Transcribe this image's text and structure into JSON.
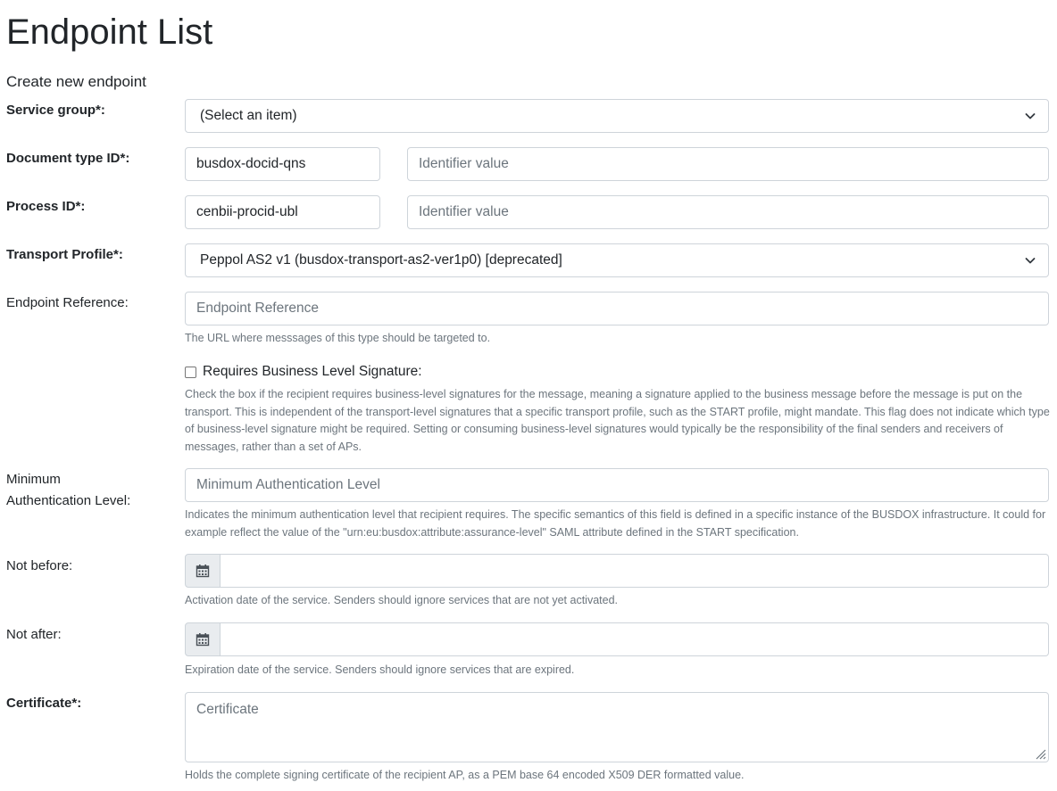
{
  "page": {
    "title": "Endpoint List",
    "subtitle": "Create new endpoint"
  },
  "service_group": {
    "label": "Service group*:",
    "selected": "(Select an item)"
  },
  "document_type": {
    "label": "Document type ID*:",
    "scheme_value": "busdox-docid-qns",
    "value_placeholder": "Identifier value"
  },
  "process": {
    "label": "Process ID*:",
    "scheme_value": "cenbii-procid-ubl",
    "value_placeholder": "Identifier value"
  },
  "transport_profile": {
    "label": "Transport Profile*:",
    "selected": "Peppol AS2 v1 (busdox-transport-as2-ver1p0) [deprecated]"
  },
  "endpoint_reference": {
    "label": "Endpoint Reference:",
    "placeholder": "Endpoint Reference",
    "hint": "The URL where messsages of this type should be targeted to."
  },
  "business_signature": {
    "label": "Requires Business Level Signature:",
    "checked": false,
    "hint": "Check the box if the recipient requires business-level signatures for the message, meaning a signature applied to the business message before the message is put on the transport. This is independent of the transport-level signatures that a specific transport profile, such as the START profile, might mandate. This flag does not indicate which type of business-level signature might be required. Setting or consuming business-level signatures would typically be the responsibility of the final senders and receivers of messages, rather than a set of APs."
  },
  "min_auth": {
    "label_line1": "Minimum",
    "label_line2": "Authentication Level:",
    "placeholder": "Minimum Authentication Level",
    "hint": "Indicates the minimum authentication level that recipient requires. The specific semantics of this field is defined in a specific instance of the BUSDOX infrastructure. It could for example reflect the value of the \"urn:eu:busdox:attribute:assurance-level\" SAML attribute defined in the START specification."
  },
  "not_before": {
    "label": "Not before:",
    "value": "",
    "icon": "calendar-icon",
    "hint": "Activation date of the service. Senders should ignore services that are not yet activated."
  },
  "not_after": {
    "label": "Not after:",
    "value": "",
    "icon": "calendar-icon",
    "hint": "Expiration date of the service. Senders should ignore services that are expired."
  },
  "certificate": {
    "label": "Certificate*:",
    "placeholder": "Certificate",
    "hint": "Holds the complete signing certificate of the recipient AP, as a PEM base 64 encoded X509 DER formatted value."
  },
  "colors": {
    "text": "#212529",
    "muted": "#6c757d",
    "border": "#ced4da",
    "addon_bg": "#e9ecef"
  }
}
